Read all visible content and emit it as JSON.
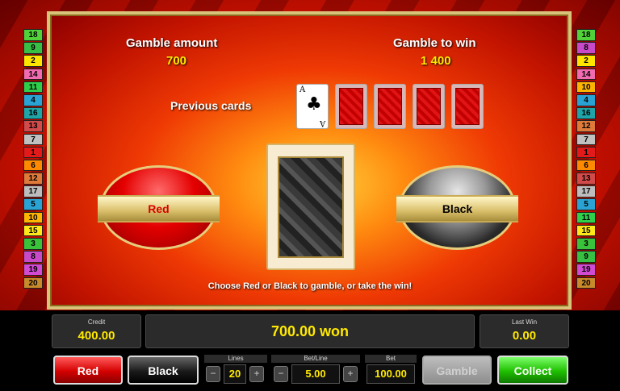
{
  "left_lines": [
    {
      "n": "18",
      "color": "#52d23a"
    },
    {
      "n": "9",
      "color": "#38c044"
    },
    {
      "n": "2",
      "color": "#ffe400"
    },
    {
      "n": "14",
      "color": "#f26bb0"
    },
    {
      "n": "11",
      "color": "#2fcf4c"
    },
    {
      "n": "4",
      "color": "#2aa3d4"
    },
    {
      "n": "16",
      "color": "#1fa4a8"
    },
    {
      "n": "13",
      "color": "#d24a4a"
    },
    {
      "n": "7",
      "color": "#c0c0c0"
    },
    {
      "n": "1",
      "color": "#e41a1a"
    },
    {
      "n": "6",
      "color": "#ff8a00"
    },
    {
      "n": "12",
      "color": "#e07a3a"
    },
    {
      "n": "17",
      "color": "#bdbdbd"
    },
    {
      "n": "5",
      "color": "#2aa3d4"
    },
    {
      "n": "10",
      "color": "#ffb400"
    },
    {
      "n": "15",
      "color": "#ffe81a"
    },
    {
      "n": "3",
      "color": "#3ac23a"
    },
    {
      "n": "8",
      "color": "#c84ac8"
    },
    {
      "n": "19",
      "color": "#d24ad2"
    },
    {
      "n": "20",
      "color": "#c88a2a"
    }
  ],
  "right_lines": [
    {
      "n": "18",
      "color": "#52d23a"
    },
    {
      "n": "8",
      "color": "#c84ac8"
    },
    {
      "n": "2",
      "color": "#ffe400"
    },
    {
      "n": "14",
      "color": "#f26bb0"
    },
    {
      "n": "10",
      "color": "#ffb400"
    },
    {
      "n": "4",
      "color": "#2aa3d4"
    },
    {
      "n": "16",
      "color": "#1fa4a8"
    },
    {
      "n": "12",
      "color": "#e07a3a"
    },
    {
      "n": "7",
      "color": "#c0c0c0"
    },
    {
      "n": "1",
      "color": "#e41a1a"
    },
    {
      "n": "6",
      "color": "#ff8a00"
    },
    {
      "n": "13",
      "color": "#d24a4a"
    },
    {
      "n": "17",
      "color": "#bdbdbd"
    },
    {
      "n": "5",
      "color": "#2aa3d4"
    },
    {
      "n": "11",
      "color": "#2fcf4c"
    },
    {
      "n": "15",
      "color": "#ffe81a"
    },
    {
      "n": "3",
      "color": "#3ac23a"
    },
    {
      "n": "9",
      "color": "#38c044"
    },
    {
      "n": "19",
      "color": "#d24ad2"
    },
    {
      "n": "20",
      "color": "#c88a2a"
    }
  ],
  "gamble": {
    "amount_label": "Gamble amount",
    "amount": "700",
    "to_win_label": "Gamble to win",
    "to_win": "1 400",
    "previous_cards_label": "Previous cards",
    "previous_card_rank": "A",
    "previous_card_suit": "♣",
    "red_label": "Red",
    "black_label": "Black",
    "hint": "Choose Red or Black to gamble, or take the win!"
  },
  "status": {
    "credit_label": "Credit",
    "credit": "400.00",
    "won_message": "700.00 won",
    "last_win_label": "Last Win",
    "last_win": "0.00"
  },
  "controls": {
    "red_button": "Red",
    "black_button": "Black",
    "lines_label": "Lines",
    "lines": "20",
    "bet_line_label": "Bet/Line",
    "bet_line": "5.00",
    "bet_label": "Bet",
    "bet": "100.00",
    "gamble_button": "Gamble",
    "collect_button": "Collect",
    "minus": "−",
    "plus": "+"
  }
}
